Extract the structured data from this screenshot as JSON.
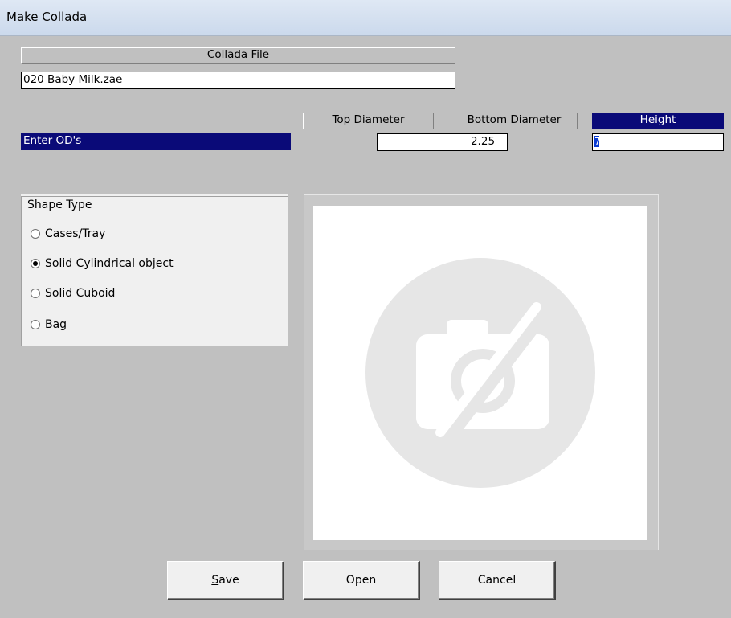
{
  "window": {
    "title": "Make Collada"
  },
  "collada": {
    "header": "Collada File",
    "value": "020 Baby Milk.zae"
  },
  "dimensions": {
    "prompt": "Enter OD's",
    "top_diameter_label": "Top Diameter",
    "top_diameter_value": "",
    "bottom_diameter_label": "Bottom Diameter",
    "bottom_diameter_value": "2.25",
    "height_label": "Height",
    "height_value": "7"
  },
  "shape_type": {
    "title": "Shape Type",
    "options": [
      {
        "label": "Cases/Tray",
        "selected": false
      },
      {
        "label": "Solid Cylindrical object",
        "selected": true
      },
      {
        "label": "Solid Cuboid",
        "selected": false
      },
      {
        "label": "Bag",
        "selected": false
      }
    ]
  },
  "preview": {
    "icon": "no-image-camera-icon"
  },
  "buttons": {
    "save_prefix": "S",
    "save_rest": "ave",
    "open": "Open",
    "cancel": "Cancel"
  },
  "colors": {
    "selection": "#0a0a78",
    "background": "#c0c0c0"
  }
}
